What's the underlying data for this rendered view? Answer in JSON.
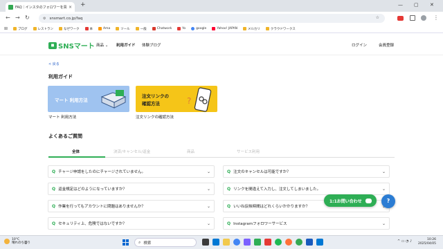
{
  "browser": {
    "tab_title": "FAQ｜インスタのフォロワーを買うなら…",
    "close_glyph": "×",
    "newtab_glyph": "+",
    "url": "snsmart.co.jp/faq",
    "window": {
      "min": "—",
      "max": "▢",
      "close": "✕"
    },
    "bookmarks": [
      "ブログ",
      "レストラン",
      "なぜワーク",
      "本",
      "Ama",
      "ツール",
      "一般",
      "Chatwork",
      "Yo",
      "google",
      "Yahoo! JAPAN",
      "メルカリ",
      "クラウドワークス"
    ]
  },
  "site": {
    "logo_text": "SNSマート",
    "nav": {
      "products": "商品",
      "products_chev": "⌄",
      "guide": "利用ガイド",
      "blog": "体験ブログ"
    },
    "login": "ログイン",
    "signup": "会員登録"
  },
  "page": {
    "back": "< 戻る",
    "guide_heading": "利用ガイド",
    "card1": {
      "title": "マート 利用方法",
      "caption": "マート 利用方法"
    },
    "card2": {
      "title_line1": "注文リンクの",
      "title_line2": "確認方法",
      "caption": "注文リンクの確認方法"
    },
    "faq_heading": "よくあるご質問",
    "tabs": [
      "全体",
      "決済/キャンセル/返金",
      "商品",
      "サービス利用"
    ],
    "questions_left": [
      "チャージ申請をしたのにチャージされていません。",
      "返金規定はどのようになっていますか？",
      "作業を行ってもアカウントに問題はありませんか？",
      "セキュリティ上、危険ではないですか？"
    ],
    "questions_right": [
      "注文のキャンセルは可能ですか？",
      "リンクを間違えて入力し、注文してしまいました。",
      "いいね反映時間はどれくらいかかりますか？",
      "Instagramフォロワーサービス"
    ],
    "q_glyph": "Q",
    "chev_glyph": "⌄"
  },
  "floating": {
    "contact": "1:1お問い合わせ",
    "help": "?"
  },
  "taskbar": {
    "temp": "10°C",
    "weather": "晴れのち曇り",
    "search": "検索",
    "time": "10:26",
    "date": "2025/04/05"
  },
  "colors": {
    "brand_green": "#2eae55",
    "card_blue": "#9fc3f0",
    "card_yellow": "#f5c518",
    "help_blue": "#2b7cd3"
  }
}
